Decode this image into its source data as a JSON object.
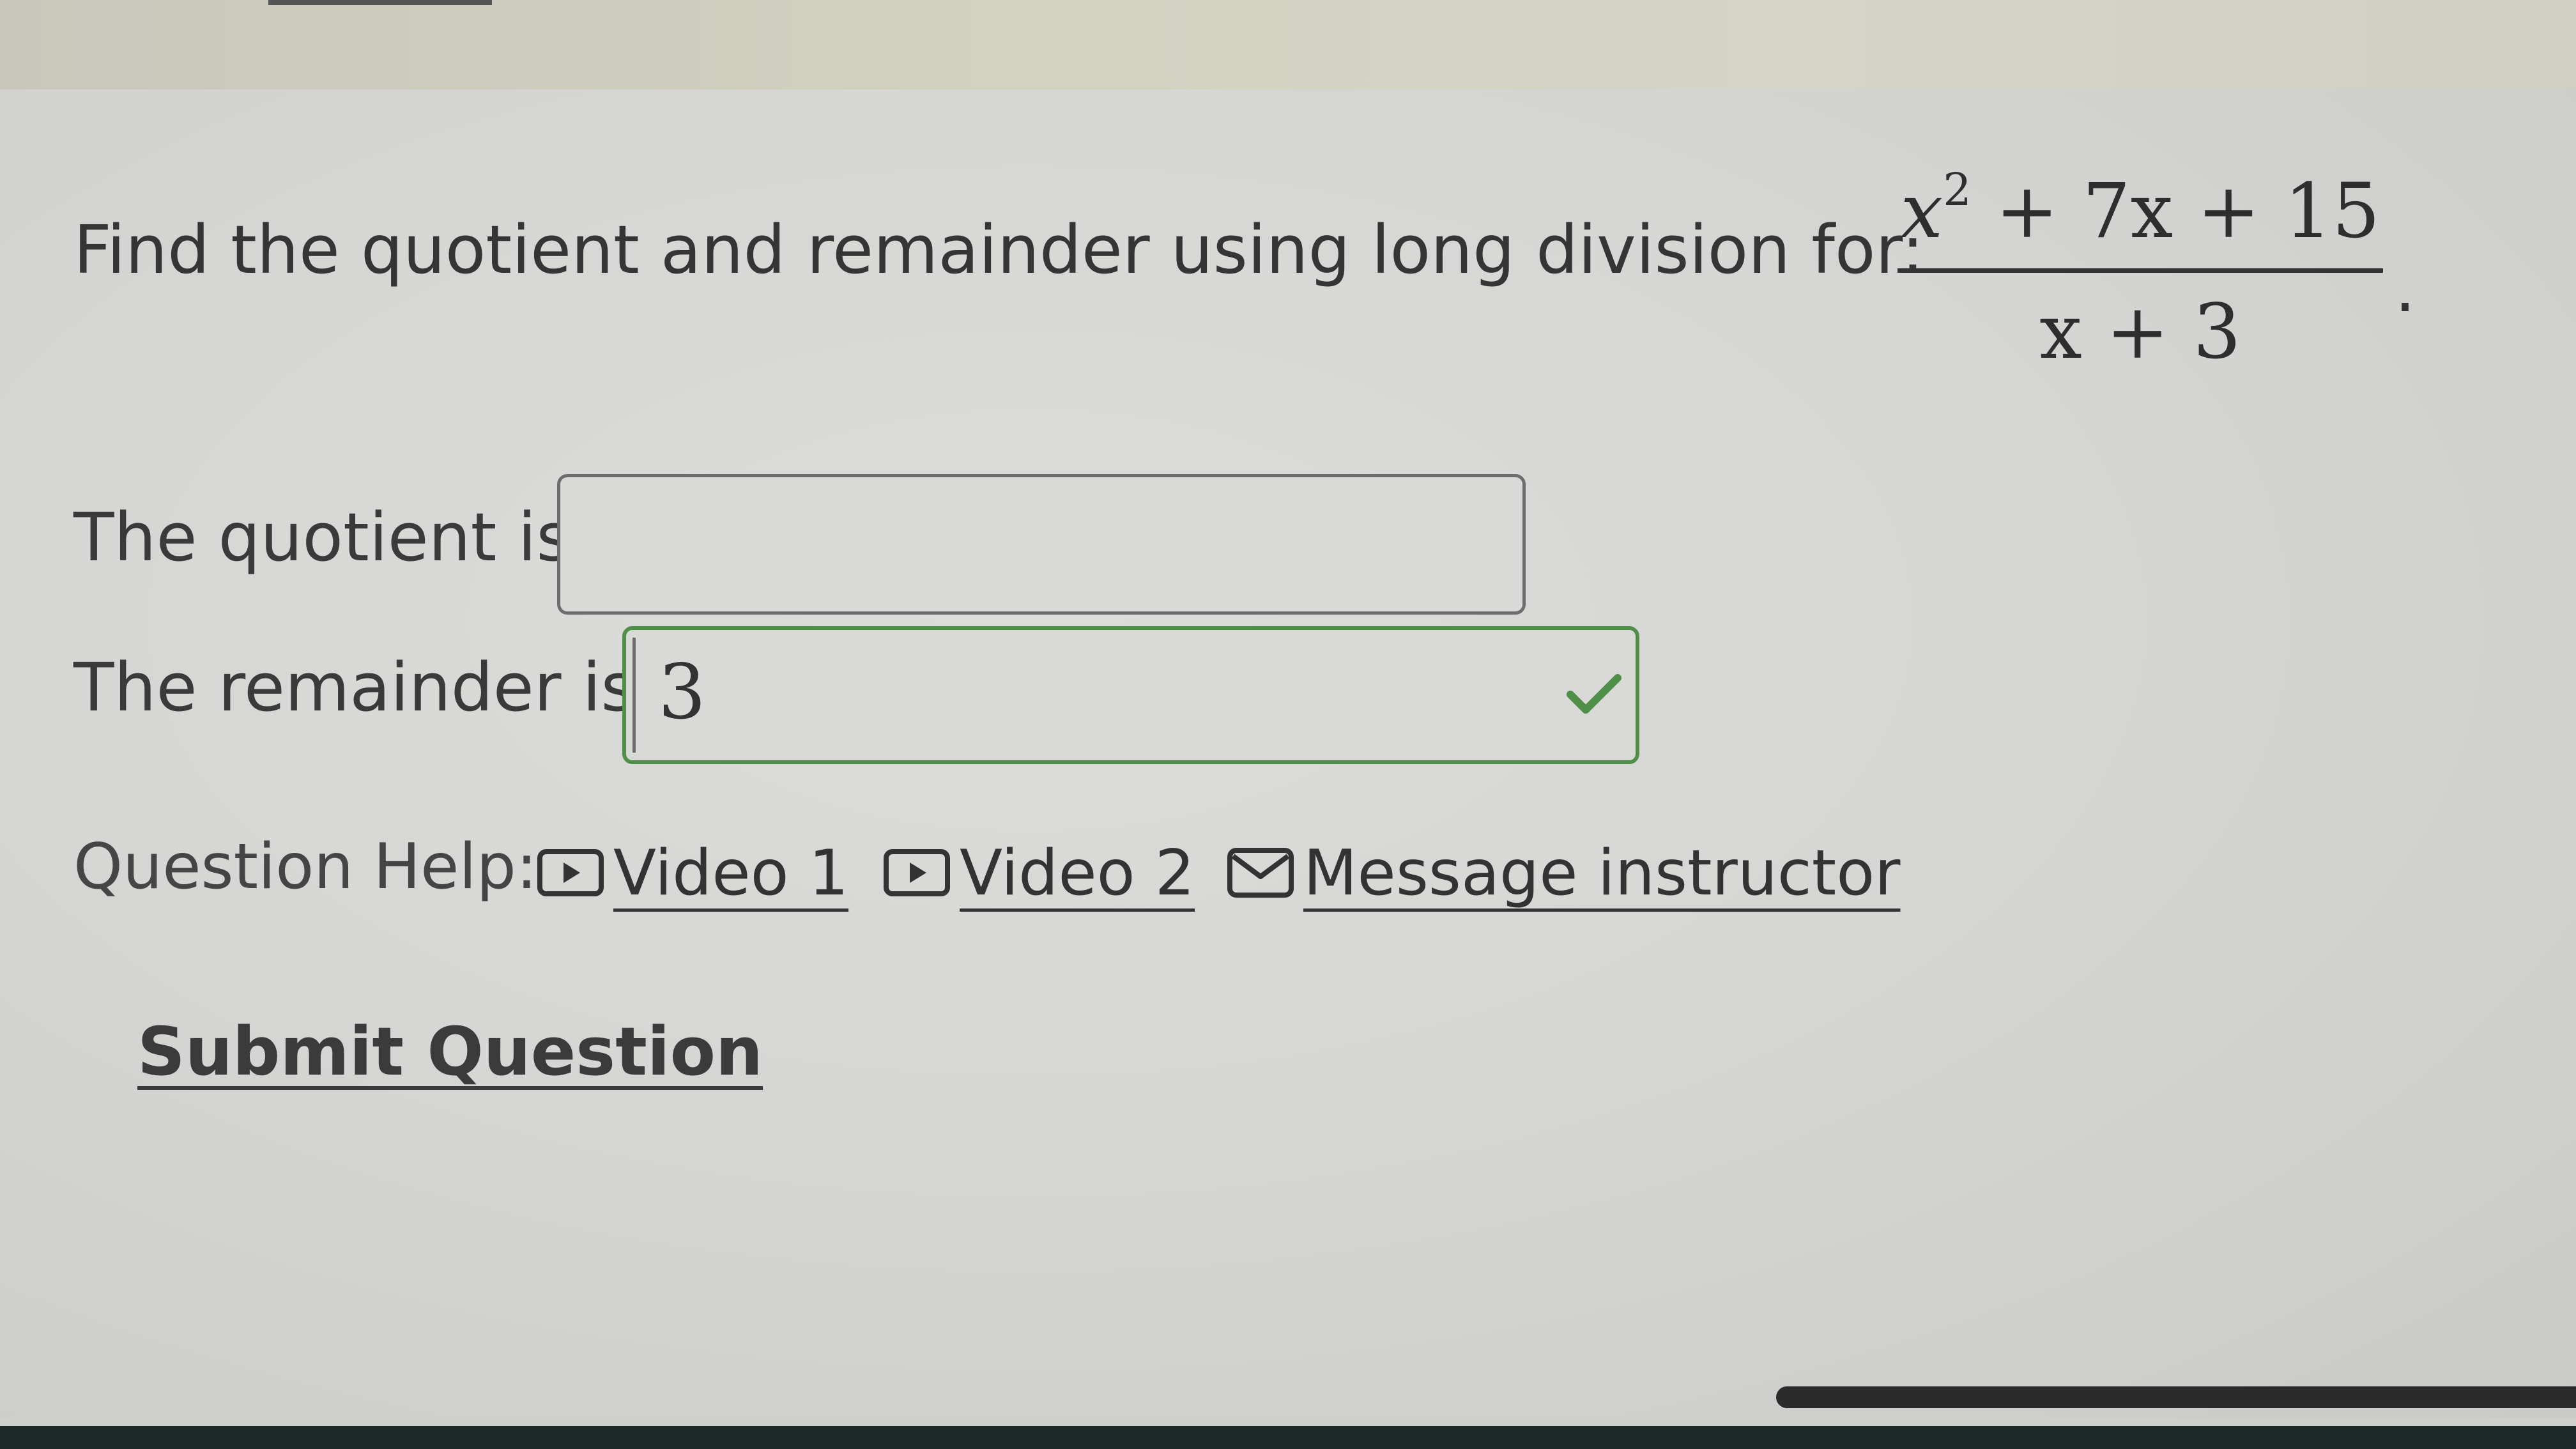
{
  "question": {
    "text": "Find the quotient and remainder using long division for:",
    "numerator": {
      "var": "x",
      "exp": "2",
      "rest": " + 7x + 15"
    },
    "denominator": "x + 3",
    "period": "."
  },
  "quotient": {
    "label": "The quotient is",
    "value": ""
  },
  "remainder": {
    "label": "The remainder is",
    "value": "3",
    "status": "correct",
    "status_color": "#4f8f47"
  },
  "help": {
    "label": "Question Help:",
    "links": [
      {
        "label": "Video 1",
        "icon": "play-icon"
      },
      {
        "label": "Video 2",
        "icon": "play-icon"
      },
      {
        "label": "Message instructor",
        "icon": "mail-icon"
      }
    ]
  },
  "submit": {
    "label": "Submit Question"
  }
}
